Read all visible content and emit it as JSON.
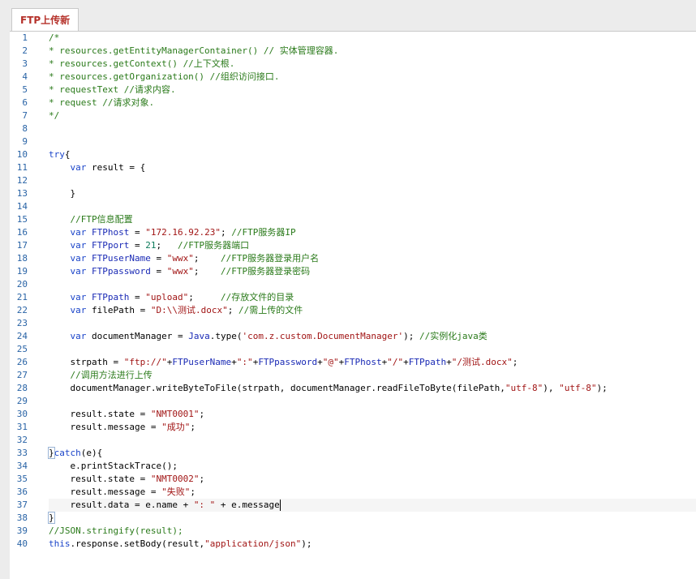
{
  "tab": {
    "title": "FTP上传新"
  },
  "editor": {
    "line_numbers": [
      "1",
      "2",
      "3",
      "4",
      "5",
      "6",
      "7",
      "8",
      "9",
      "10",
      "11",
      "12",
      "13",
      "14",
      "15",
      "16",
      "17",
      "18",
      "19",
      "20",
      "21",
      "22",
      "23",
      "24",
      "25",
      "26",
      "27",
      "28",
      "29",
      "30",
      "31",
      "32",
      "33",
      "34",
      "35",
      "36",
      "37",
      "38",
      "39",
      "40"
    ],
    "lines": [
      [
        [
          "c-com",
          "/*"
        ]
      ],
      [
        [
          "c-com",
          "* resources.getEntityManagerContainer() // 实体管理容器."
        ]
      ],
      [
        [
          "c-com",
          "* resources.getContext() //上下文根."
        ]
      ],
      [
        [
          "c-com",
          "* resources.getOrganization() //组织访问接口."
        ]
      ],
      [
        [
          "c-com",
          "* requestText //请求内容."
        ]
      ],
      [
        [
          "c-com",
          "* request //请求对象."
        ]
      ],
      [
        [
          "c-com",
          "*/"
        ]
      ],
      [],
      [],
      [
        [
          "c-kw",
          "try"
        ],
        [
          "c-def",
          "{"
        ]
      ],
      [
        [
          "c-def",
          "    "
        ],
        [
          "c-kw",
          "var"
        ],
        [
          "c-def",
          " result = {"
        ]
      ],
      [],
      [
        [
          "c-def",
          "    }"
        ]
      ],
      [],
      [
        [
          "c-def",
          "    "
        ],
        [
          "c-com",
          "//FTP信息配置"
        ]
      ],
      [
        [
          "c-def",
          "    "
        ],
        [
          "c-kw",
          "var"
        ],
        [
          "c-var",
          " FTPhost"
        ],
        [
          "c-def",
          " = "
        ],
        [
          "c-str",
          "\"172.16.92.23\""
        ],
        [
          "c-def",
          "; "
        ],
        [
          "c-com",
          "//FTP服务器IP"
        ]
      ],
      [
        [
          "c-def",
          "    "
        ],
        [
          "c-kw",
          "var"
        ],
        [
          "c-var",
          " FTPport"
        ],
        [
          "c-def",
          " = "
        ],
        [
          "c-num",
          "21"
        ],
        [
          "c-def",
          ";   "
        ],
        [
          "c-com",
          "//FTP服务器端口"
        ]
      ],
      [
        [
          "c-def",
          "    "
        ],
        [
          "c-kw",
          "var"
        ],
        [
          "c-var",
          " FTPuserName"
        ],
        [
          "c-def",
          " = "
        ],
        [
          "c-str",
          "\"wwx\""
        ],
        [
          "c-def",
          ";    "
        ],
        [
          "c-com",
          "//FTP服务器登录用户名"
        ]
      ],
      [
        [
          "c-def",
          "    "
        ],
        [
          "c-kw",
          "var"
        ],
        [
          "c-var",
          " FTPpassword"
        ],
        [
          "c-def",
          " = "
        ],
        [
          "c-str",
          "\"wwx\""
        ],
        [
          "c-def",
          ";    "
        ],
        [
          "c-com",
          "//FTP服务器登录密码"
        ]
      ],
      [],
      [
        [
          "c-def",
          "    "
        ],
        [
          "c-kw",
          "var"
        ],
        [
          "c-var",
          " FTPpath"
        ],
        [
          "c-def",
          " = "
        ],
        [
          "c-str",
          "\"upload\""
        ],
        [
          "c-def",
          ";     "
        ],
        [
          "c-com",
          "//存放文件的目录"
        ]
      ],
      [
        [
          "c-def",
          "    "
        ],
        [
          "c-kw",
          "var"
        ],
        [
          "c-def",
          " filePath = "
        ],
        [
          "c-str",
          "\"D:\\\\测试.docx\""
        ],
        [
          "c-def",
          "; "
        ],
        [
          "c-com",
          "//需上传的文件"
        ]
      ],
      [],
      [
        [
          "c-def",
          "    "
        ],
        [
          "c-kw",
          "var"
        ],
        [
          "c-def",
          " documentManager = "
        ],
        [
          "c-var",
          "Java"
        ],
        [
          "c-def",
          ".type("
        ],
        [
          "c-str",
          "'com.z.custom.DocumentManager'"
        ],
        [
          "c-def",
          "); "
        ],
        [
          "c-com",
          "//实例化java类"
        ]
      ],
      [],
      [
        [
          "c-def",
          "    strpath = "
        ],
        [
          "c-str",
          "\"ftp://\""
        ],
        [
          "c-def",
          "+"
        ],
        [
          "c-var",
          "FTPuserName"
        ],
        [
          "c-def",
          "+"
        ],
        [
          "c-str",
          "\":\""
        ],
        [
          "c-def",
          "+"
        ],
        [
          "c-var",
          "FTPpassword"
        ],
        [
          "c-def",
          "+"
        ],
        [
          "c-str",
          "\"@\""
        ],
        [
          "c-def",
          "+"
        ],
        [
          "c-var",
          "FTPhost"
        ],
        [
          "c-def",
          "+"
        ],
        [
          "c-str",
          "\"/\""
        ],
        [
          "c-def",
          "+"
        ],
        [
          "c-var",
          "FTPpath"
        ],
        [
          "c-def",
          "+"
        ],
        [
          "c-str",
          "\"/测试.docx\""
        ],
        [
          "c-def",
          ";"
        ]
      ],
      [
        [
          "c-def",
          "    "
        ],
        [
          "c-com",
          "//调用方法进行上传"
        ]
      ],
      [
        [
          "c-def",
          "    documentManager.writeByteToFile(strpath, documentManager.readFileToByte(filePath,"
        ],
        [
          "c-str",
          "\"utf-8\""
        ],
        [
          "c-def",
          "), "
        ],
        [
          "c-str",
          "\"utf-8\""
        ],
        [
          "c-def",
          ");"
        ]
      ],
      [],
      [
        [
          "c-def",
          "    result.state = "
        ],
        [
          "c-str",
          "\"NMT0001\""
        ],
        [
          "c-def",
          ";"
        ]
      ],
      [
        [
          "c-def",
          "    result.message = "
        ],
        [
          "c-str",
          "\"成功\""
        ],
        [
          "c-def",
          ";"
        ]
      ],
      [],
      [
        [
          "c-def bm",
          "}"
        ],
        [
          "c-kw",
          "catch"
        ],
        [
          "c-def",
          "(e){"
        ]
      ],
      [
        [
          "c-def",
          "    e.printStackTrace();"
        ]
      ],
      [
        [
          "c-def",
          "    result.state = "
        ],
        [
          "c-str",
          "\"NMT0002\""
        ],
        [
          "c-def",
          ";"
        ]
      ],
      [
        [
          "c-def",
          "    result.message = "
        ],
        [
          "c-str",
          "\"失败\""
        ],
        [
          "c-def",
          ";"
        ]
      ],
      [
        [
          "c-def",
          "    result.data = e.name + "
        ],
        [
          "c-str",
          "\": \""
        ],
        [
          "c-def",
          " + e.message"
        ]
      ],
      [
        [
          "c-def bm",
          "}"
        ]
      ],
      [
        [
          "c-com",
          "//JSON.stringify(result);"
        ]
      ],
      [
        [
          "c-kw",
          "this"
        ],
        [
          "c-def",
          ".response.setBody(result,"
        ],
        [
          "c-str",
          "\"application/json\""
        ],
        [
          "c-def",
          ");"
        ]
      ]
    ],
    "active_line_index": 36
  }
}
